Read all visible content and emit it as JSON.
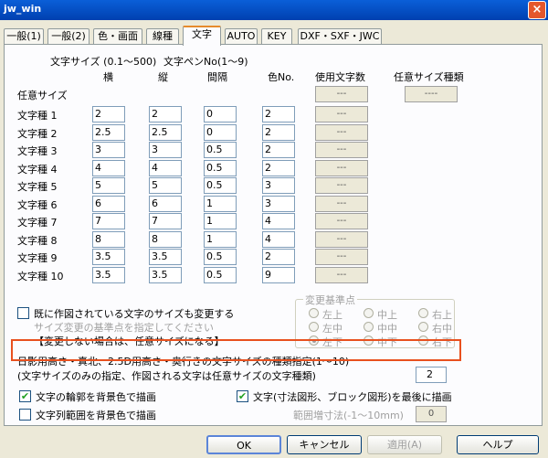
{
  "window": {
    "title": "jw_win",
    "close_glyph": "×"
  },
  "tabs": [
    "一般(1)",
    "一般(2)",
    "色・画面",
    "線種",
    "文字",
    "AUTO",
    "KEY",
    "DXF・SXF・JWC"
  ],
  "active_tab": "文字",
  "headers": {
    "size_range": "文字サイズ (0.1～500)",
    "pen_range": "文字ペンNo(1～9)",
    "col_width": "横",
    "col_height": "縦",
    "col_spacing": "間隔",
    "col_color": "色No.",
    "col_used": "使用文字数",
    "col_free_types": "任意サイズ種類"
  },
  "free_size": {
    "label": "任意サイズ",
    "used": "---",
    "types": "----"
  },
  "rows": [
    {
      "label": "文字種 1",
      "w": "2",
      "h": "2",
      "sp": "0",
      "c": "2",
      "used": "---"
    },
    {
      "label": "文字種 2",
      "w": "2.5",
      "h": "2.5",
      "sp": "0",
      "c": "2",
      "used": "---"
    },
    {
      "label": "文字種 3",
      "w": "3",
      "h": "3",
      "sp": "0.5",
      "c": "2",
      "used": "---"
    },
    {
      "label": "文字種 4",
      "w": "4",
      "h": "4",
      "sp": "0.5",
      "c": "2",
      "used": "---"
    },
    {
      "label": "文字種 5",
      "w": "5",
      "h": "5",
      "sp": "0.5",
      "c": "3",
      "used": "---"
    },
    {
      "label": "文字種 6",
      "w": "6",
      "h": "6",
      "sp": "1",
      "c": "3",
      "used": "---"
    },
    {
      "label": "文字種 7",
      "w": "7",
      "h": "7",
      "sp": "1",
      "c": "4",
      "used": "---"
    },
    {
      "label": "文字種 8",
      "w": "8",
      "h": "8",
      "sp": "1",
      "c": "4",
      "used": "---"
    },
    {
      "label": "文字種 9",
      "w": "3.5",
      "h": "3.5",
      "sp": "0.5",
      "c": "2",
      "used": "---"
    },
    {
      "label": "文字種 10",
      "w": "3.5",
      "h": "3.5",
      "sp": "0.5",
      "c": "9",
      "used": "---"
    }
  ],
  "change_existing": {
    "label": "既に作図されている文字のサイズも変更する",
    "hint": "サイズ変更の基準点を指定してください",
    "note": "【変更しない場合は、任意サイズになる】"
  },
  "anchor_group": {
    "title": "変更基準点",
    "options": [
      "左上",
      "中上",
      "右上",
      "左中",
      "中中",
      "右中",
      "左下",
      "中下",
      "右下"
    ],
    "selected": "左下"
  },
  "shadow_text": {
    "line1": "日影用高さ・真北、2.5D用高さ・奥行きの文字サイズの種類指定(1～10)",
    "line2": "(文字サイズのみの指定、作図される文字は任意サイズの文字種類)",
    "value": "2"
  },
  "options": {
    "outline_bg": "文字の輪郭を背景色で描画",
    "draw_last": "文字(寸法図形、ブロック図形)を最後に描画",
    "range_bg": "文字列範囲を背景色で描画",
    "range_margin_label": "範囲増寸法(-1～10mm)",
    "range_margin_value": "0",
    "check_mark": "✔"
  },
  "buttons": {
    "ok": "OK",
    "cancel": "キャンセル",
    "apply": "適用(A)",
    "help": "ヘルプ"
  }
}
